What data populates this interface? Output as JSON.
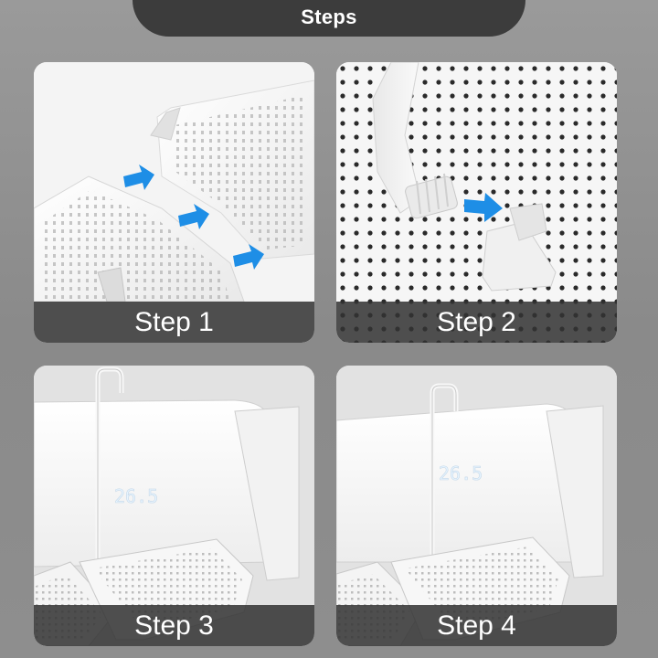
{
  "header": {
    "title": "Steps"
  },
  "steps": [
    {
      "label": "Step 1"
    },
    {
      "label": "Step 2"
    },
    {
      "label": "Step 3"
    },
    {
      "label": "Step 4"
    }
  ],
  "display": {
    "temperature": "26.5"
  },
  "colors": {
    "arrow": "#1e8ee6",
    "caption_bg": "#323232",
    "header_bg": "#3c3c3c"
  }
}
